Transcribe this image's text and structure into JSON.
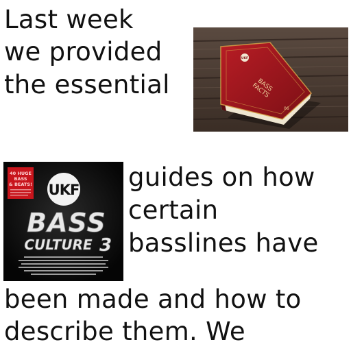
{
  "text_blocks": {
    "line1": "Last week",
    "line2": "we provided",
    "line3": "the essential",
    "line4": "guides on how",
    "line5": "certain",
    "line6": "basslines have",
    "line7": "been made and how to",
    "line8": "describe them. We"
  },
  "book_image": {
    "spine_title": "BASS",
    "spine_title2": "FACTS",
    "volume": "06",
    "emblem": "UKF"
  },
  "album_cover": {
    "logo": "UKF",
    "title_top": "BASS",
    "title_bottom": "CULTURE",
    "number": "3",
    "sticker_line1": "40 HUGE",
    "sticker_line2": "BASS",
    "sticker_line3": "& BEATS!"
  },
  "colors": {
    "text": "#111111",
    "book_red": "#a4161e",
    "wood": "#4a3a30"
  }
}
